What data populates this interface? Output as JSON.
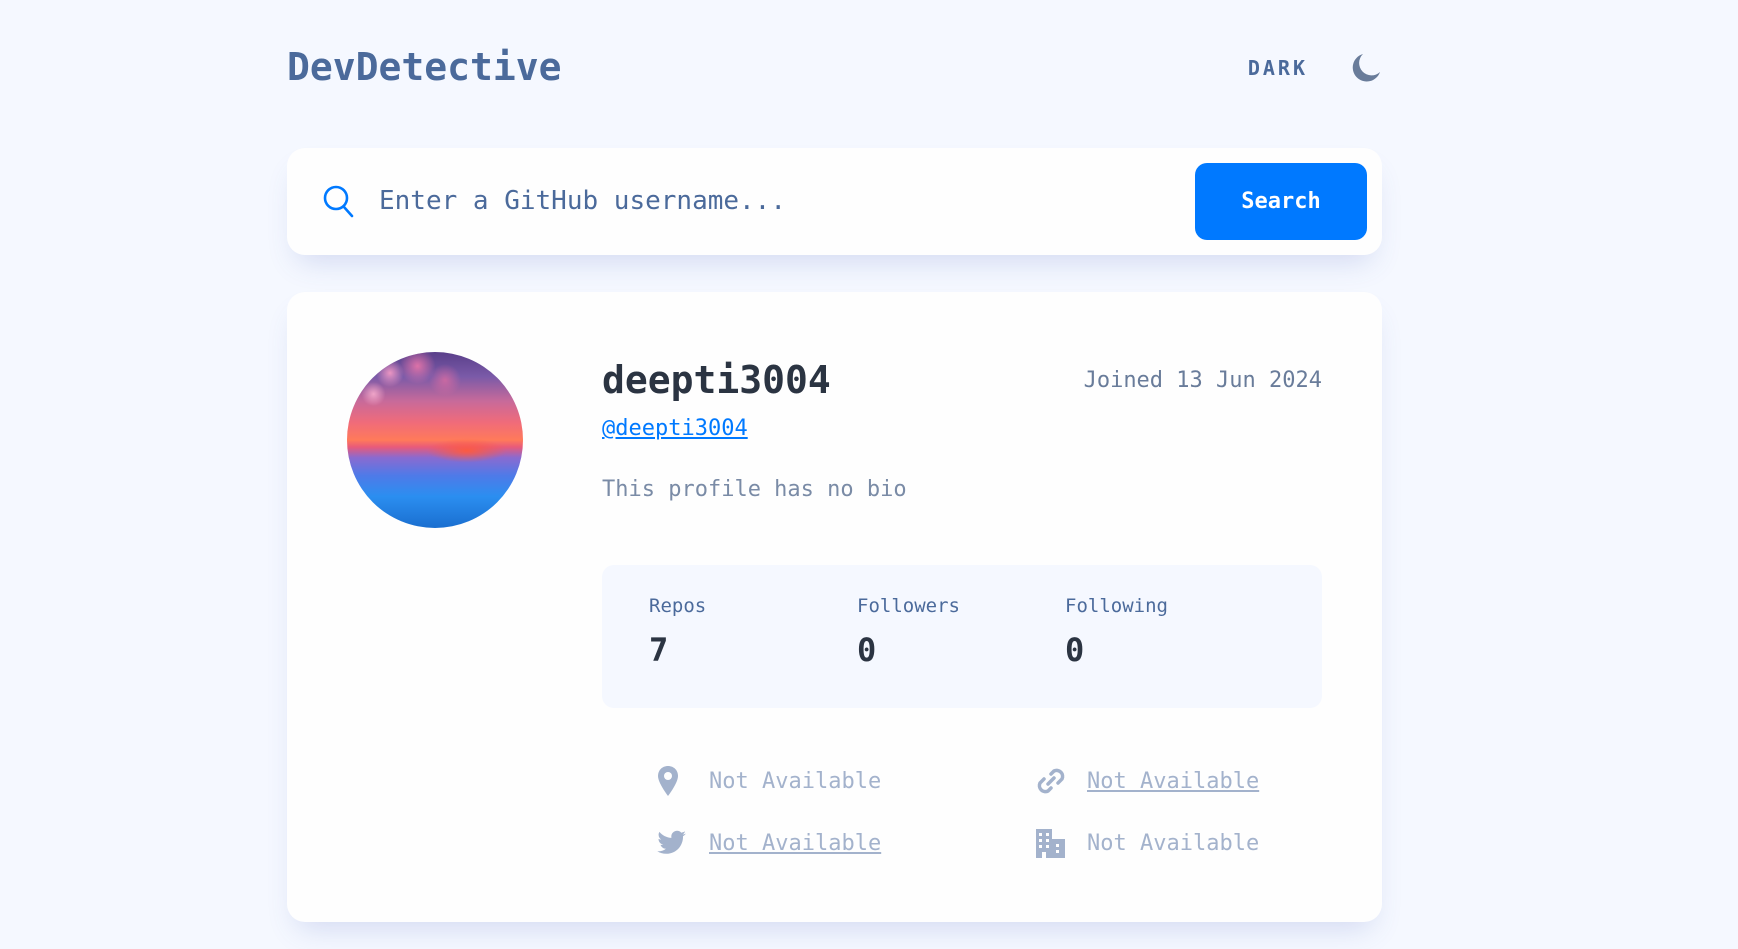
{
  "header": {
    "brand": "DevDetective",
    "theme_label": "DARK",
    "theme_icon": "moon-icon"
  },
  "search": {
    "icon": "search-icon",
    "placeholder": "Enter a GitHub username...",
    "button_label": "Search"
  },
  "profile": {
    "name": "deepti3004",
    "joined": "Joined 13 Jun 2024",
    "login": "@deepti3004",
    "bio": "This profile has no bio",
    "stats": {
      "repos_label": "Repos",
      "repos_value": "7",
      "followers_label": "Followers",
      "followers_value": "0",
      "following_label": "Following",
      "following_value": "0"
    },
    "links": {
      "location": "Not Available",
      "website": "Not Available",
      "twitter": "Not Available",
      "company": "Not Available"
    }
  },
  "colors": {
    "background": "#f5f8ff",
    "card": "#fefefe",
    "accent": "#0079ff",
    "brand_text": "#4b6a9b",
    "heading_text": "#2b3442",
    "muted_text": "#a3b2cc"
  }
}
